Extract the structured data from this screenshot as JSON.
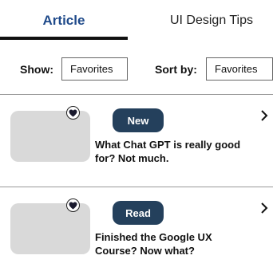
{
  "tabs": [
    {
      "label": "Article",
      "active": true
    },
    {
      "label": "UI Design Tips",
      "active": false
    }
  ],
  "filters": {
    "show_label": "Show:",
    "show_value": "Favorites",
    "sort_label": "Sort by:",
    "sort_value": "Favorites"
  },
  "articles": [
    {
      "badge": "New",
      "title": "What Chat GPT is really good for? Not much.",
      "favorite_icon": "heart-icon",
      "chevron_icon": "chevron-right-icon"
    },
    {
      "badge": "Read",
      "title": "Finished the Google UX Course? Now what?",
      "favorite_icon": "heart-icon",
      "chevron_icon": "chevron-right-icon"
    }
  ],
  "colors": {
    "active_tab": "#1f4a8a",
    "badge_bg": "#24405c",
    "thumbnail": "#d9d9d9"
  }
}
